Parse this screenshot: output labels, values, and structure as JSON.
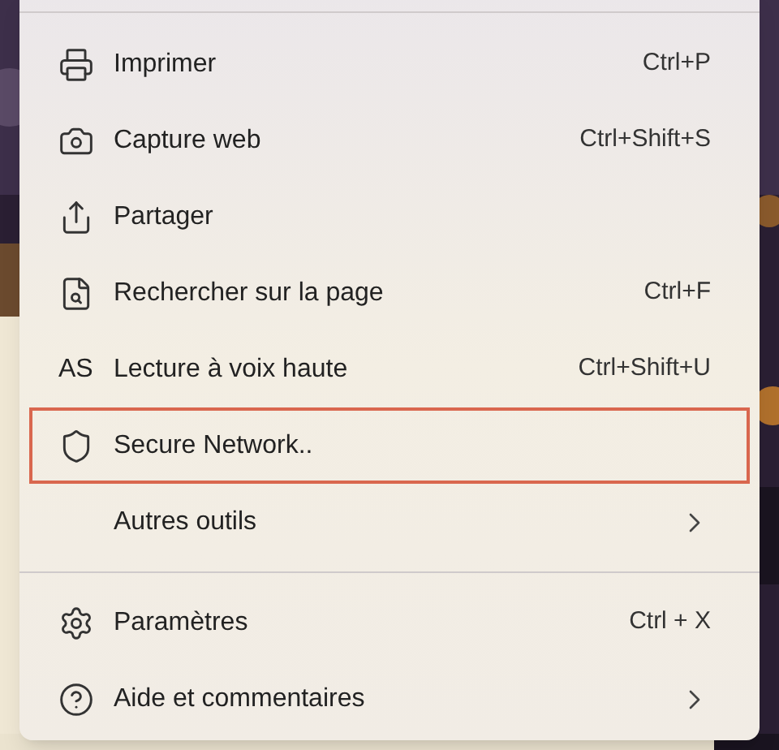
{
  "menu": {
    "items": [
      {
        "label": "Imprimer",
        "shortcut": "Ctrl+P",
        "selected": false,
        "submenu": false
      },
      {
        "label": "Capture web",
        "shortcut": "Ctrl+Shift+S",
        "selected": false,
        "submenu": false
      },
      {
        "label": "Partager",
        "selected": false,
        "submenu": false
      },
      {
        "label": "Rechercher sur la page",
        "shortcut": "Ctrl+F",
        "selected": false,
        "submenu": false
      },
      {
        "label": "Lecture à voix haute",
        "glyph": "AS",
        "shortcut": "Ctrl+Shift+U",
        "selected": false,
        "submenu": false
      },
      {
        "label": "Secure Network..",
        "selected": true,
        "submenu": false
      },
      {
        "label": "Autres outils",
        "selected": false,
        "submenu": true,
        "divider_after": true
      },
      {
        "label": "Paramètres",
        "shortcut": "Ctrl + X",
        "selected": false,
        "submenu": false
      },
      {
        "label": "Aide et commentaires",
        "selected": false,
        "submenu": true
      }
    ]
  }
}
